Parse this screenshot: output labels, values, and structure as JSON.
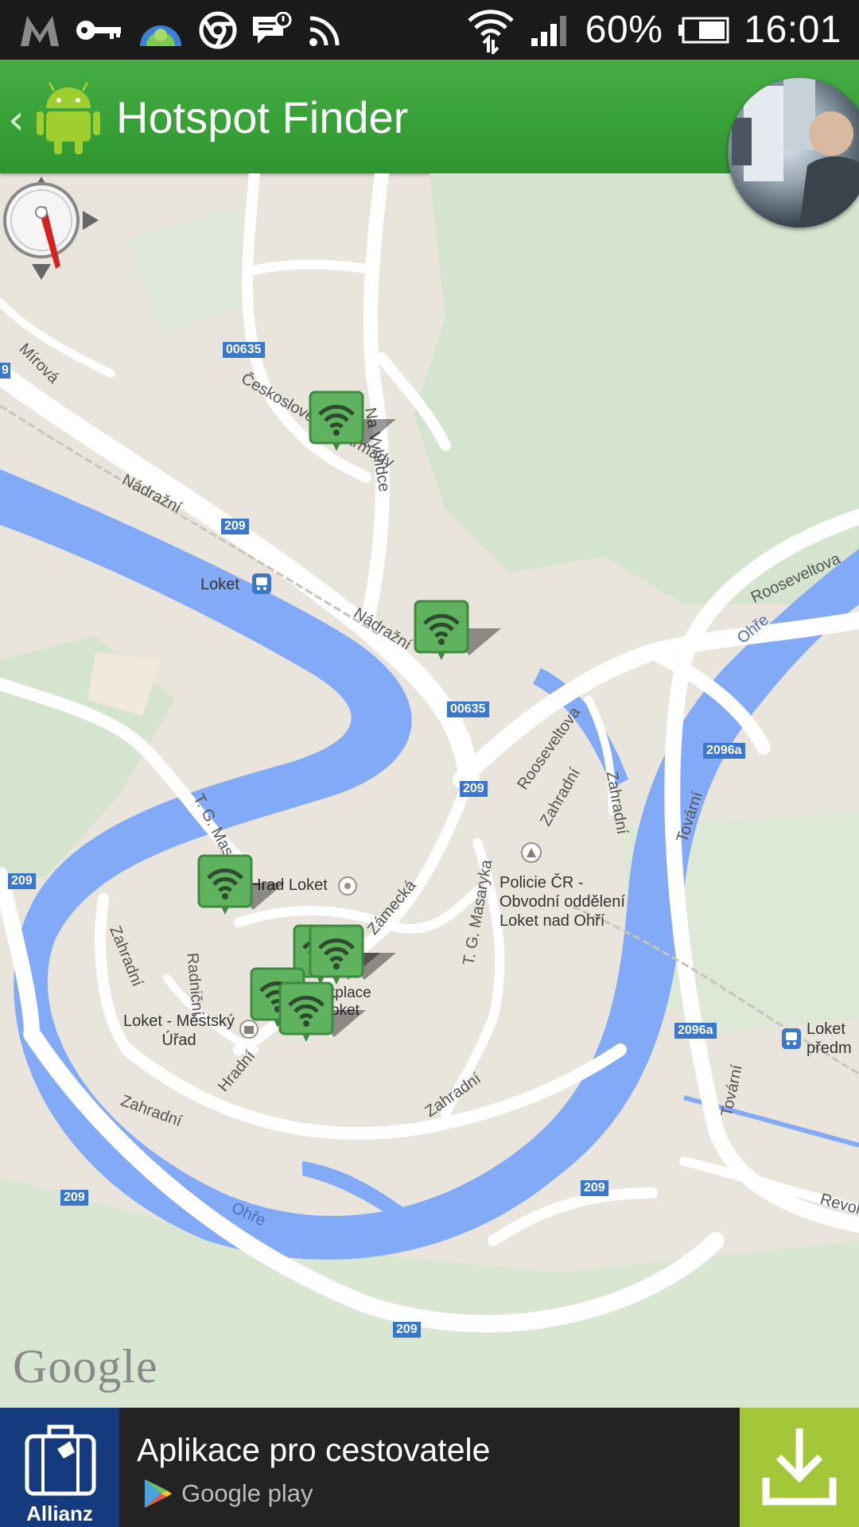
{
  "status_bar": {
    "battery_percent": "60%",
    "time": "16:01"
  },
  "app_bar": {
    "title": "Hotspot Finder"
  },
  "map": {
    "provider_logo": "Google",
    "streets": [
      "Mírová",
      "Nádražní",
      "Nádražní",
      "Na Vyhlídce",
      "Československé armády",
      "Rooseveltova",
      "Rooseveltova",
      "Zahradní",
      "Zahradní",
      "Zahradní",
      "Zahradní",
      "Zahradní",
      "Tovární",
      "Tovární",
      "T. G. Masaryka",
      "T. G. Masaryka",
      "Zámecká",
      "Radniční",
      "Hradní",
      "Revoluční"
    ],
    "rivers": [
      "Ohře",
      "Ohře"
    ],
    "road_shields": [
      "00635",
      "209",
      "00635",
      "209",
      "209",
      "2096a",
      "2096a",
      "209",
      "209",
      "209",
      "9"
    ],
    "places": {
      "station": "Loket",
      "castle": "Hrad Loket",
      "police": "Policie ČR - Obvodní oddělení Loket nad Ohří",
      "town_hall": "Loket - Městský Úřad",
      "market_fragment": "tplace oket",
      "station_east": "Loket předm"
    },
    "hotspot_count": 7
  },
  "ad": {
    "brand": "Allianz",
    "headline": "Aplikace pro cestovatele",
    "store": "Google play"
  },
  "colors": {
    "app_bar": "#3aa33a",
    "water": "#7fa8f5",
    "hotspot": "#55a855",
    "ad_download": "#a4c639",
    "ad_brand": "#163a7e"
  }
}
